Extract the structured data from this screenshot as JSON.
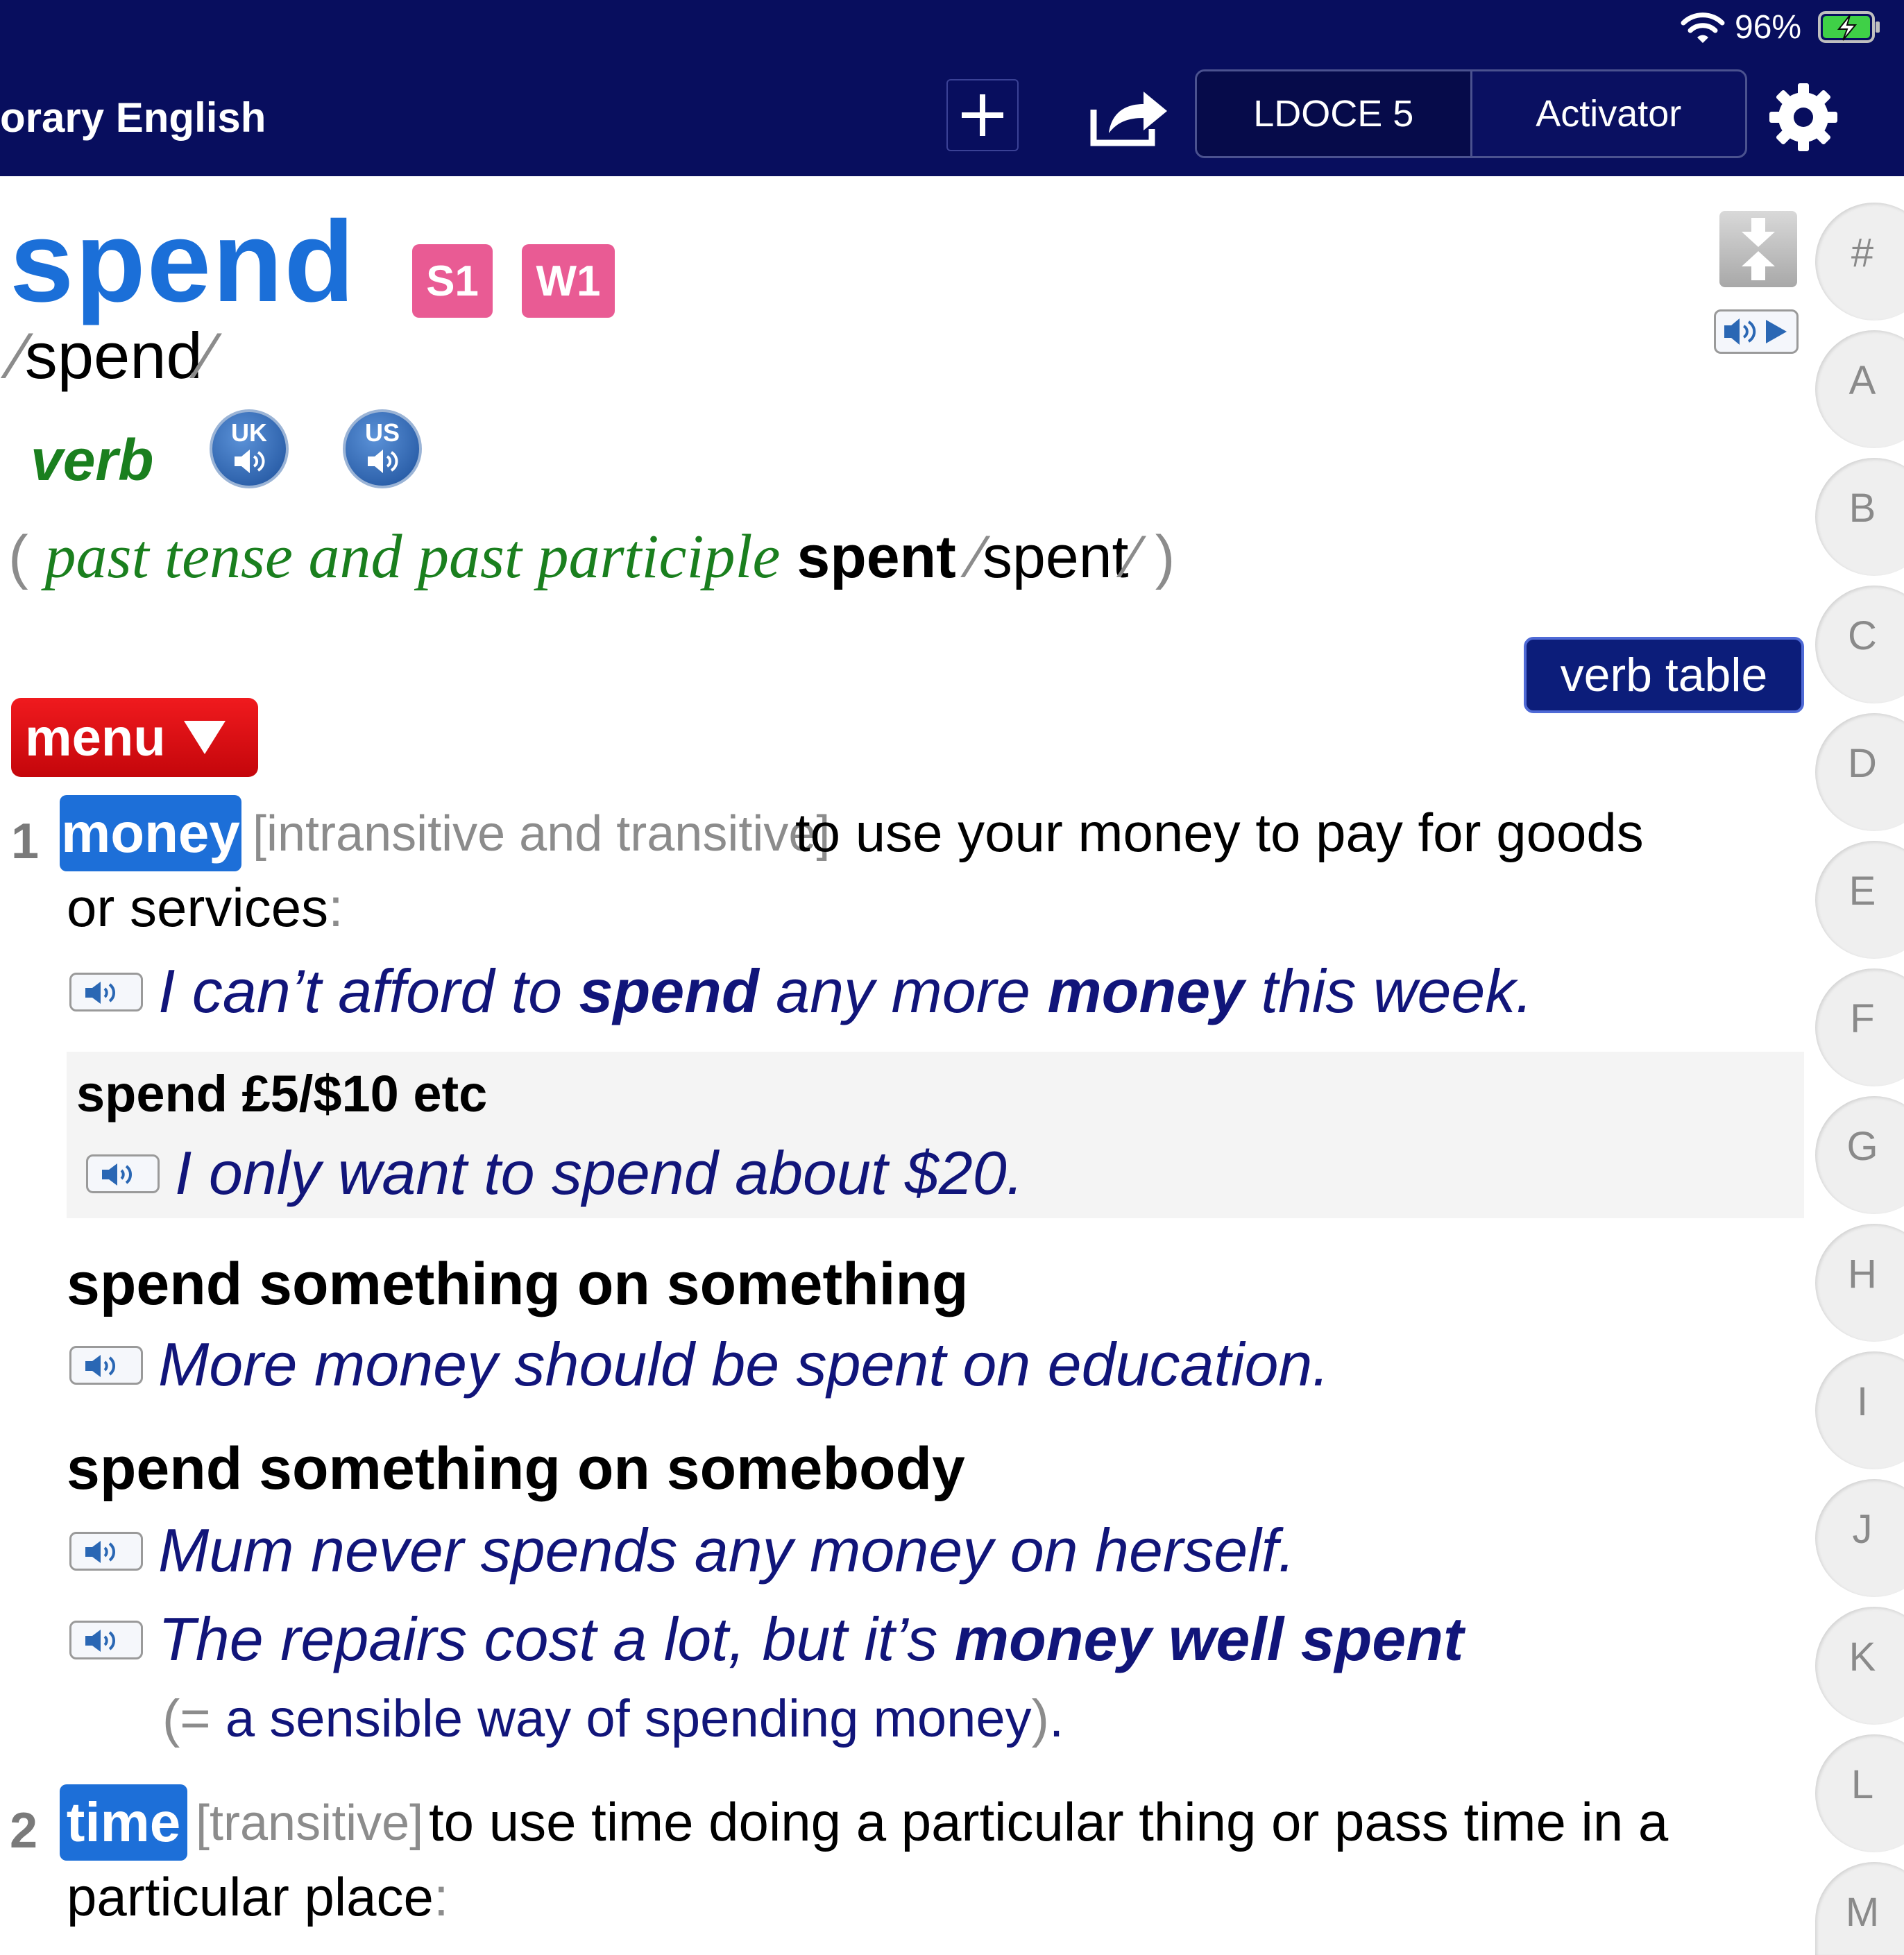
{
  "status": {
    "battery_pct": "96%"
  },
  "header": {
    "title": "orary English",
    "segments": [
      "LDOCE 5",
      "Activator"
    ],
    "icons": {
      "add": "plus-icon",
      "share": "share-icon",
      "settings": "gear-icon"
    }
  },
  "entry": {
    "headword": "spend",
    "freq_badges": [
      "S1",
      "W1"
    ],
    "pronunciation": "spend",
    "pos": "verb",
    "audio": {
      "uk": "UK",
      "us": "US"
    },
    "forms": {
      "label": "past tense and past participle",
      "word": "spent",
      "pron": "spent"
    },
    "verb_table_label": "verb table",
    "menu_label": "menu"
  },
  "senses": [
    {
      "num": "1",
      "signpost": "money",
      "grammar": "[intransitive and transitive]",
      "def_line1": "to use your money to pay for goods",
      "def_line2": "or services",
      "examples": [
        {
          "pre": "I can’t afford to ",
          "b1": "spend",
          "mid": " any more ",
          "b2": "money",
          "post": " this week."
        }
      ],
      "collocations": [
        {
          "phrase": "spend £5/$10 etc",
          "examples": [
            "I only want to spend about $20."
          ]
        },
        {
          "phrase": "spend something on something",
          "examples": [
            "More money should be spent on education."
          ]
        },
        {
          "phrase": "spend something on somebody",
          "examples": [
            "Mum never spends any money on herself."
          ]
        }
      ],
      "last_example": {
        "pre": "The repairs cost a lot, but it’s ",
        "bold": "money well spent",
        "gloss": "a sensible way of spending money"
      }
    },
    {
      "num": "2",
      "signpost": "time",
      "grammar": "[transitive]",
      "def_line1": "to use time doing a particular thing or pass time in a",
      "def_line2": "particular place"
    }
  ],
  "alphabet": [
    "#",
    "A",
    "B",
    "C",
    "D",
    "E",
    "F",
    "G",
    "H",
    "I",
    "J",
    "K",
    "L",
    "M"
  ],
  "colors": {
    "topbar": "#080e5e",
    "headword": "#1b6fd8",
    "badge": "#e95b94",
    "pos": "#1a7f1e",
    "example": "#11157a",
    "menu": "#e30f14"
  }
}
